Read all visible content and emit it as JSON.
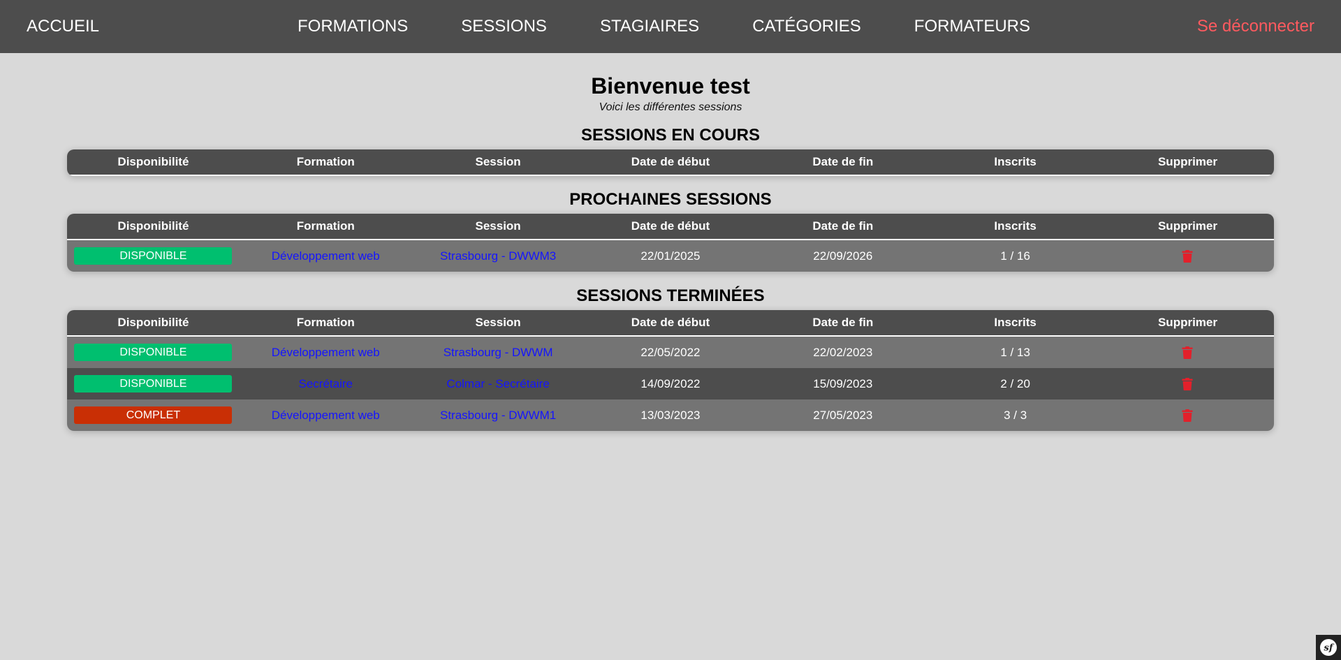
{
  "nav": {
    "home": "ACCUEIL",
    "links": [
      "FORMATIONS",
      "SESSIONS",
      "STAGIAIRES",
      "CATÉGORIES",
      "FORMATEURS"
    ],
    "logout": "Se déconnecter"
  },
  "header": {
    "title": "Bienvenue test",
    "subtitle": "Voici les différentes sessions"
  },
  "columns": [
    "Disponibilité",
    "Formation",
    "Session",
    "Date de début",
    "Date de fin",
    "Inscrits",
    "Supprimer"
  ],
  "sections": {
    "current": {
      "title": "SESSIONS EN COURS",
      "rows": []
    },
    "upcoming": {
      "title": "PROCHAINES SESSIONS",
      "rows": [
        {
          "status": "DISPONIBLE",
          "formation": "Développement web",
          "session": "Strasbourg - DWWM3",
          "start": "22/01/2025",
          "end": "22/09/2026",
          "enrolled": "1 / 16"
        }
      ]
    },
    "finished": {
      "title": "SESSIONS TERMINÉES",
      "rows": [
        {
          "status": "DISPONIBLE",
          "formation": "Développement web",
          "session": "Strasbourg - DWWM",
          "start": "22/05/2022",
          "end": "22/02/2023",
          "enrolled": "1 / 13"
        },
        {
          "status": "DISPONIBLE",
          "formation": "Secrétaire",
          "session": "Colmar - Secrétaire",
          "start": "14/09/2022",
          "end": "15/09/2023",
          "enrolled": "2 / 20"
        },
        {
          "status": "COMPLET",
          "formation": "Développement web",
          "session": "Strasbourg - DWWM1",
          "start": "13/03/2023",
          "end": "27/05/2023",
          "enrolled": "3 / 3"
        }
      ]
    }
  },
  "colors": {
    "available": "#00bf6f",
    "full": "#c92f05",
    "delete": "#e2202b",
    "link": "#1515ff",
    "logout": "#ff5a5f"
  },
  "icons": {
    "delete": "trash-icon",
    "symfony": "symfony-logo-icon"
  }
}
